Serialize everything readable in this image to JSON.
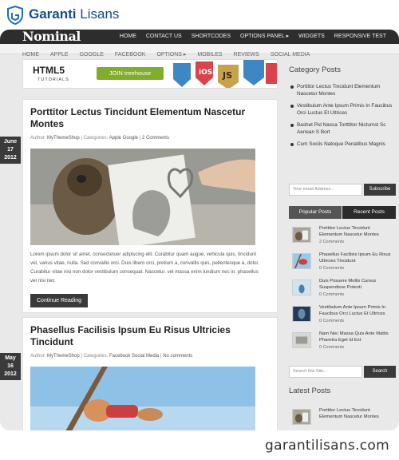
{
  "brand": {
    "name_bold": "Garanti",
    "name_rest": " Lisans"
  },
  "site": {
    "title": "Nominal"
  },
  "top_nav": [
    "HOME",
    "CONTACT US",
    "SHORTCODES",
    "OPTIONS PANEL ▸",
    "WIDGETS",
    "RESPONSIVE TEST"
  ],
  "sub_nav": [
    "HOME",
    "APPLE",
    "GOOGLE",
    "FACEBOOK",
    "OPTIONS ▸",
    "MOBILES",
    "REVIEWS",
    "SOCIAL MEDIA"
  ],
  "banner": {
    "heading": "HTML5",
    "subheading": "TUTORIALS",
    "cta": "JOIN treehouse",
    "ios": "iOS",
    "js": "JS",
    "colors": {
      "green": "#7fae2b",
      "ios": "#d9434b",
      "js": "#c8a24a",
      "css": "#3f86c4"
    }
  },
  "posts": [
    {
      "date": [
        "June",
        "17",
        "2012"
      ],
      "title": "Porttitor Lectus Tincidunt Elementum Nascetur Montes",
      "author_label": "Author:",
      "author": "MyThemeShop",
      "categories_label": "Categories:",
      "categories": "Apple Google",
      "comments": "2 Comments",
      "excerpt": "Lorem ipsum dolor sit amet, consectetuer adipiscing elit. Curabitur quam augue, vehicula quis, tincidunt vel, varius vitae, nulla. Sed convallis orci. Duis libero orci, pretium a, convallis quis, pellentesque a, dolor. Curabitur vitae nisi non dolor vestibulum consequat. Nascetur. vel massa enim lundium nec in. phasellus vel nisi nec",
      "button": "Continue Reading"
    },
    {
      "date": [
        "May",
        "16",
        "2012"
      ],
      "title": "Phasellus Facilisis Ipsum Eu Risus Ultricies Tincidunt",
      "author_label": "Author:",
      "author": "MyThemeShop",
      "categories_label": "Categories:",
      "categories": "Facebook Social Media",
      "comments": "No comments"
    }
  ],
  "sidebar": {
    "category_heading": "Category Posts",
    "category_posts": [
      "Porttitor Lectus Tincidunt Elementum Nascetur Montes",
      "Vestibulum Ante Ipsum Primis In Faucibus Orci Luctus Et Ultrices",
      "Bashet Pid Nassa Tortttitor Nictumst Sc Aenean S Bort",
      "Cum Sociis Natoque Penatibus Magnis"
    ],
    "email_placeholder": "Your email Address...",
    "subscribe": "Subscribe",
    "tab_popular": "Popular Posts",
    "tab_recent": "Recent Posts",
    "popular": [
      {
        "title": "Porttitor Lectus Tincidunt Elementum Nascetur Montes",
        "comments": "2 Comments"
      },
      {
        "title": "Phasellus Facilisis Ipsum Eu Risus Ultricies Tincidunt",
        "comments": "0 Comments"
      },
      {
        "title": "Duis Posuere Mollis Cursus Suspendisse Potenti",
        "comments": "0 Comments"
      },
      {
        "title": "Vestibulum Ante Ipsum Primis In Faucibus Orci Luctus Et Ultrices",
        "comments": "0 Comments"
      },
      {
        "title": "Nam Nec Massa Quis Ante Mattis Pharetra Eget Id Est",
        "comments": "0 Comments"
      }
    ],
    "search_placeholder": "Search this Site...",
    "search_button": "Search",
    "latest_heading": "Latest Posts",
    "latest": [
      {
        "title": "Porttitor Lectus Tincidunt Elementum Nascetur Montes"
      }
    ]
  },
  "footer_url": "garantilisans.com"
}
